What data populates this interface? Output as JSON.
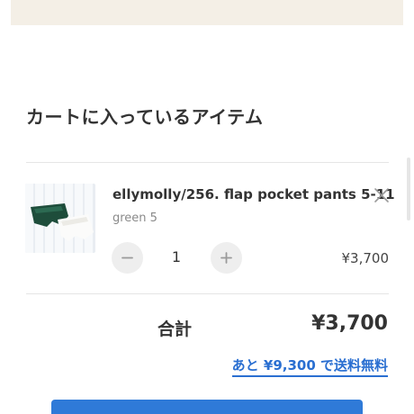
{
  "cart": {
    "heading": "カートに入っているアイテム",
    "items": [
      {
        "name": "ellymolly/256. flap pocket pants 5-11",
        "variant": "green 5",
        "quantity": "1",
        "price": "¥3,700",
        "remove_icon": "close-icon",
        "decrement_icon": "minus-icon",
        "increment_icon": "plus-icon"
      }
    ]
  },
  "summary": {
    "total_label": "合計",
    "total_value": "¥3,700",
    "free_shipping_notice": "あと ¥9,300 で送料無料"
  },
  "colors": {
    "accent": "#2a6fd1",
    "checkout_button": "#2f7ad8",
    "banner": "#f4efe6",
    "text": "#333333",
    "muted": "#8a8a8a"
  }
}
